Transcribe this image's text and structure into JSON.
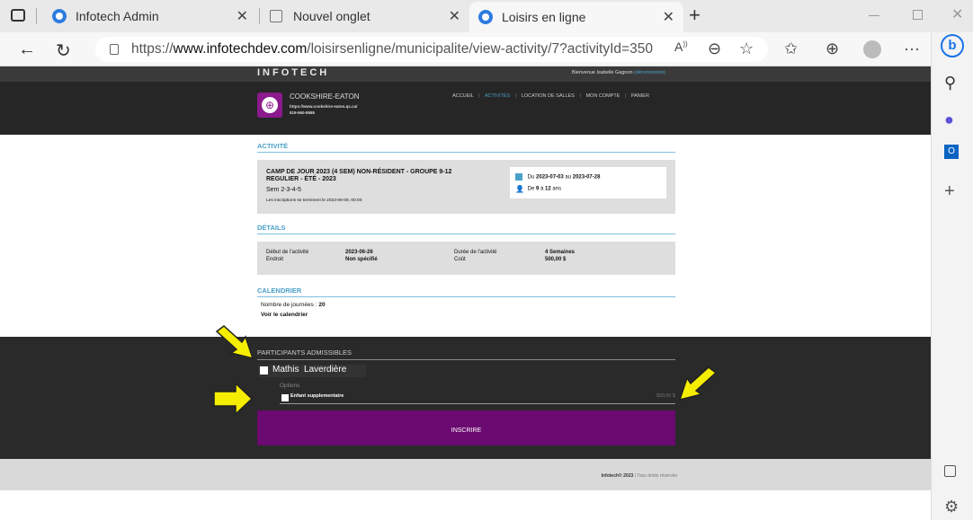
{
  "browser": {
    "tabs": [
      {
        "title": "Infotech Admin"
      },
      {
        "title": "Nouvel onglet"
      },
      {
        "title": "Loisirs en ligne"
      }
    ],
    "url_prefix": "https://",
    "url_domain": "www.infotechdev.com",
    "url_path": "/loisirsenligne/municipalite/view-activity/7?activityId=350",
    "new_tab": "+",
    "more": "···"
  },
  "site": {
    "brand": "INFOTECH",
    "welcome": "Bienvenue Isabelle Gagnon",
    "welcome_link": "(déconnexion)",
    "org_name": "COOKSHIRE-EATON",
    "org_url": "https://www.cookshire-eaton.qc.ca/",
    "org_phone": "819-560-8585",
    "nav": [
      "ACCUEIL",
      "ACTIVITÉS",
      "LOCATION DE SALLES",
      "MON COMPTE",
      "PANIER"
    ]
  },
  "activity": {
    "section_title": "ACTIVITÉ",
    "name_line1": "CAMP DE JOUR 2023 (4 SEM) NON-RÉSIDENT - GROUPE 9-12",
    "name_line2": "REGULIER - ÉTÉ - 2023",
    "sem": "Sem 2-3-4-5",
    "closing": "Les inscriptions se terminent le 2023-06-09, 00:00",
    "date_prefix": "Du",
    "date_from": "2023-07-03",
    "date_mid": "au",
    "date_to": "2023-07-28",
    "age_prefix": "De",
    "age_from": "9",
    "age_mid": "à",
    "age_to": "12",
    "age_suffix": "ans"
  },
  "details": {
    "section_title": "DÉTAILS",
    "start_label": "Début de l'activité",
    "start_value": "2023-06-26",
    "place_label": "Endroit",
    "place_value": "Non spécifié",
    "duration_label": "Durée de l'activité",
    "duration_value": "4 Semaines",
    "cost_label": "Coût",
    "cost_value": "500,00 $"
  },
  "calendar": {
    "section_title": "CALENDRIER",
    "days_label": "Nombre de journées :",
    "days_value": "20",
    "link": "Voir le calendrier"
  },
  "participants": {
    "section_title": "PARTICIPANTS ADMISSIBLES",
    "name": "Mathis  Laverdière",
    "options_label": "Options",
    "option_name": "Enfant supplementaire",
    "option_price": "300,00 $",
    "submit": "INSCRIRE"
  },
  "footer": {
    "copyright": "Infotech© 2023",
    "rights": "Tous droits réservés"
  },
  "colors": {
    "accent": "#4aa0c9",
    "submit_bg": "#6b0a70",
    "arrow": "#f5ee00"
  }
}
